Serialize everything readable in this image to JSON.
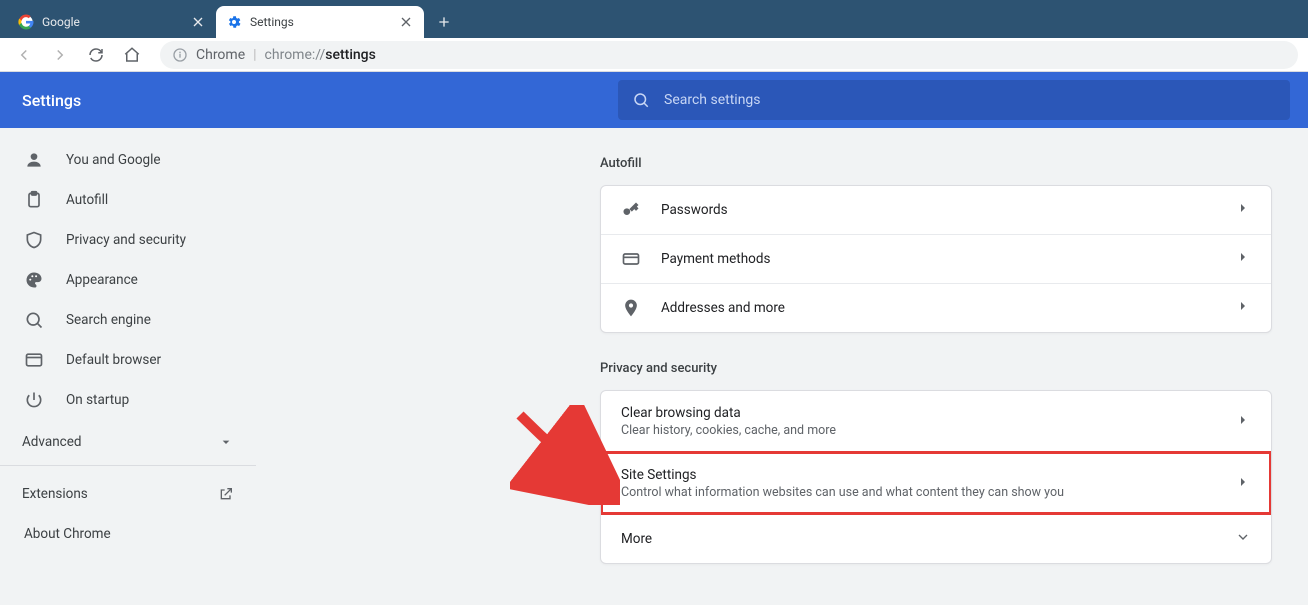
{
  "tabs": {
    "google": "Google",
    "settings": "Settings"
  },
  "omnibox": {
    "context": "Chrome",
    "url_prefix": "chrome://",
    "url_bold": "settings"
  },
  "header": {
    "title": "Settings",
    "search_placeholder": "Search settings"
  },
  "sidebar": {
    "items": [
      "You and Google",
      "Autofill",
      "Privacy and security",
      "Appearance",
      "Search engine",
      "Default browser",
      "On startup"
    ],
    "advanced": "Advanced",
    "extensions": "Extensions",
    "about": "About Chrome"
  },
  "sections": {
    "autofill": {
      "title": "Autofill",
      "rows": [
        {
          "title": "Passwords"
        },
        {
          "title": "Payment methods"
        },
        {
          "title": "Addresses and more"
        }
      ]
    },
    "privacy": {
      "title": "Privacy and security",
      "rows": [
        {
          "title": "Clear browsing data",
          "sub": "Clear history, cookies, cache, and more"
        },
        {
          "title": "Site Settings",
          "sub": "Control what information websites can use and what content they can show you"
        },
        {
          "title": "More"
        }
      ]
    }
  }
}
